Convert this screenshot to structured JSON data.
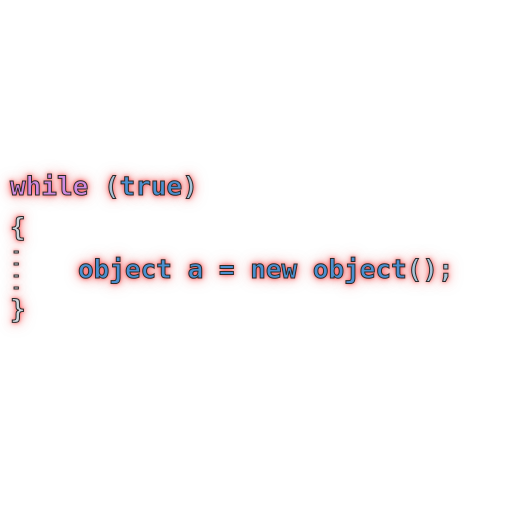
{
  "code": {
    "line1": {
      "keyword": "while",
      "space": " ",
      "open_paren": "(",
      "literal": "true",
      "close_paren": ")"
    },
    "line2": {
      "open_brace": "{"
    },
    "line3": {
      "type": "object",
      "var": " a = ",
      "new_kw": "new",
      "ctor": " object",
      "call": "();"
    },
    "line4": {
      "close_brace": "}"
    }
  },
  "colors": {
    "keyword_while": "#d08be0",
    "keyword_blue": "#4a90d0",
    "glow": "#ff5050",
    "background": "#ffffff"
  }
}
